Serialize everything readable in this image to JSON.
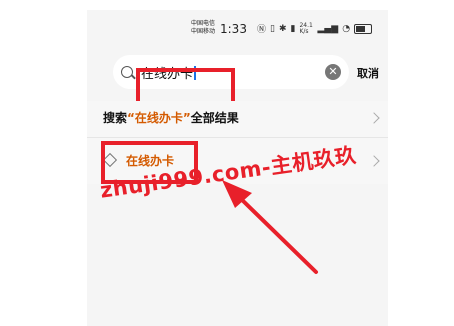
{
  "status_bar": {
    "carrier_1": "中国电信",
    "carrier_2": "中国移动",
    "time": "1:33",
    "net_speed": "24.1 K/s"
  },
  "search": {
    "value": "在线办卡",
    "cancel_label": "取消"
  },
  "results": {
    "all_results_prefix": "搜索",
    "all_results_keyword": "“在线办卡”",
    "all_results_suffix": "全部结果",
    "suggestion_label": "在线办卡"
  },
  "watermark": "zhuji999.com-主机玖玖",
  "colors": {
    "highlight": "#e8202a",
    "keyword": "#d45a00",
    "background": "#f5f5f5"
  },
  "icons": [
    "search-icon",
    "clear-icon",
    "chevron-right-icon",
    "cube-icon",
    "battery-icon",
    "wifi-icon"
  ]
}
